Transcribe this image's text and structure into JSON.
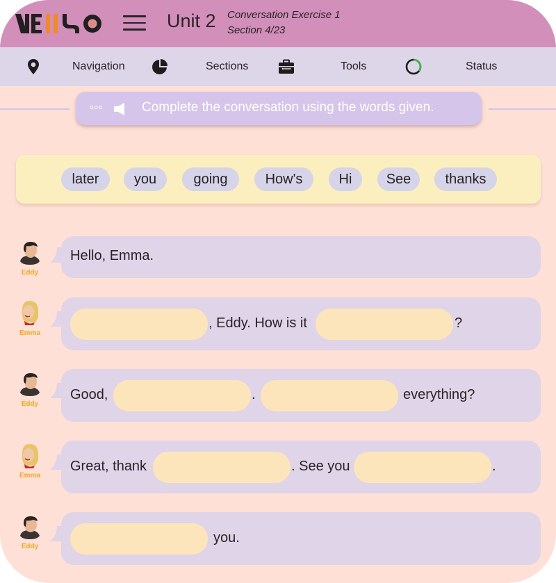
{
  "header": {
    "brand": "VELLSO",
    "unit": "Unit 2",
    "exercise": "Conversation Exercise 1",
    "section": "Section 4/23",
    "colors": {
      "header_bg": "#d28fba",
      "navbar_bg": "#ddd5e8",
      "page_bg": "#fee0d6",
      "logo_dark": "#231f20",
      "logo_accent": "#f08a24"
    }
  },
  "nav": {
    "items": [
      {
        "icon": "map-pin-icon",
        "label": "Navigation"
      },
      {
        "icon": "pie-chart-icon",
        "label": "Sections"
      },
      {
        "icon": "toolbox-icon",
        "label": "Tools"
      },
      {
        "icon": "progress-ring-icon",
        "label": "Status"
      }
    ],
    "status_progress": 0.35,
    "status_color": "#3cb54a"
  },
  "instruction": {
    "dots": "ooo",
    "icon": "speaker-icon",
    "text": "Complete the conversation using the words given."
  },
  "word_bank": {
    "words": [
      "later",
      "you",
      "going",
      "How's",
      "Hi",
      "See",
      "thanks"
    ]
  },
  "dialogue": [
    {
      "speaker": "Eddy",
      "segments": [
        "Hello, Emma."
      ]
    },
    {
      "speaker": "Emma",
      "segments": [
        "",
        ", Eddy. How is it",
        "",
        "?"
      ]
    },
    {
      "speaker": "Eddy",
      "segments": [
        "Good,",
        "",
        ".",
        "",
        "everything?"
      ]
    },
    {
      "speaker": "Emma",
      "segments": [
        "Great, thank",
        "",
        ". See you",
        "",
        "."
      ]
    },
    {
      "speaker": "Eddy",
      "segments": [
        "",
        "you."
      ]
    }
  ],
  "blank_color": "#fde5bb",
  "speaker_color": "#f5a623"
}
